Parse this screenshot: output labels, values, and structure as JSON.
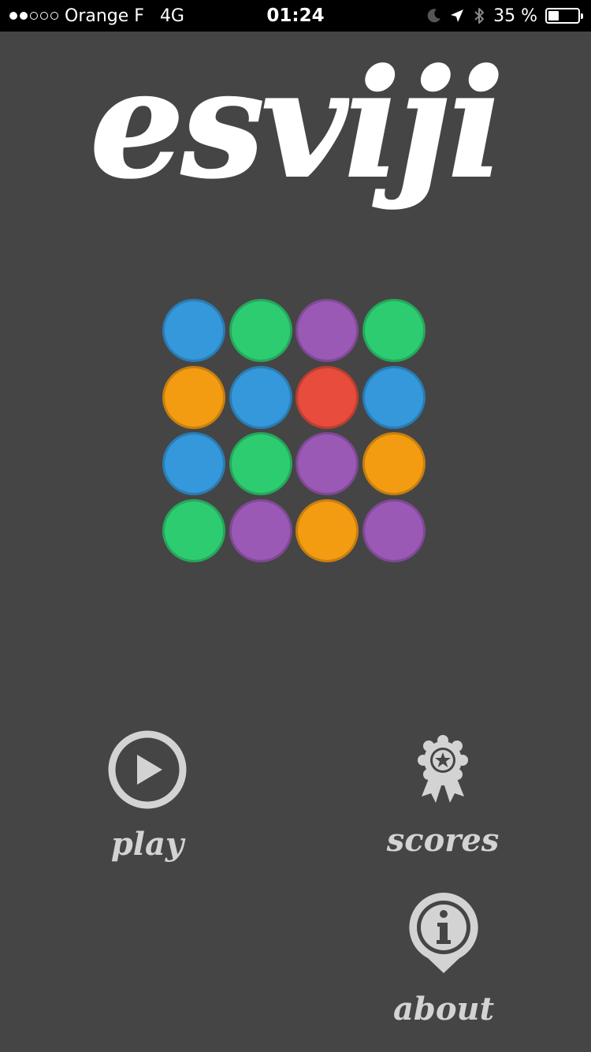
{
  "status_bar": {
    "signal_dots": [
      true,
      true,
      false,
      false,
      false
    ],
    "carrier": "Orange F",
    "network": "4G",
    "time": "01:24",
    "battery_text": "35 %",
    "battery_level": 0.35,
    "icons": [
      "moon-icon",
      "location-arrow-icon",
      "bluetooth-icon",
      "battery-icon"
    ]
  },
  "logo": {
    "text": "esviji",
    "color": "#ffffff"
  },
  "grid": {
    "rows": [
      [
        "#3498db",
        "#2ecc71",
        "#9b59b6",
        "#2ecc71"
      ],
      [
        "#f39c12",
        "#3498db",
        "#e74c3c",
        "#3498db"
      ],
      [
        "#3498db",
        "#2ecc71",
        "#9b59b6",
        "#f39c12"
      ],
      [
        "#2ecc71",
        "#9b59b6",
        "#f39c12",
        "#9b59b6"
      ]
    ]
  },
  "menu": {
    "play": {
      "label": "play",
      "icon": "play-circle-icon"
    },
    "scores": {
      "label": "scores",
      "icon": "award-ribbon-icon"
    },
    "about": {
      "label": "about",
      "icon": "info-pin-icon"
    }
  },
  "colors": {
    "background": "#454545",
    "menu_text": "#d3d3d3",
    "status_bar": "#000000"
  }
}
